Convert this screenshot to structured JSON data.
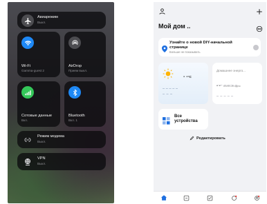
{
  "control_center": {
    "airplane": {
      "label": "Авиарежим",
      "status": "Выкл."
    },
    "wifi": {
      "label": "Wi-Fi",
      "status": "Gamma-guest 2"
    },
    "airdrop": {
      "label": "AirDrop",
      "status": "Прием выкл."
    },
    "cellular": {
      "label": "Сотовые данные",
      "status": "Вкл."
    },
    "bluetooth": {
      "label": "Bluetooth",
      "status": "Вкл. 1"
    },
    "hotspot": {
      "label": "Режим модема",
      "status": "Выкл."
    },
    "vpn": {
      "label": "VPN",
      "status": "Выкл."
    },
    "colors": {
      "airplane": "#4c4c50",
      "wifi": "#1e88f5",
      "airdrop": "#4c4c50",
      "cellular": "#34c759",
      "bluetooth": "#1e88f5"
    }
  },
  "app": {
    "home_title": "Мой дом ..",
    "banner": {
      "title": "Узнайте о новой DIY-начальной странице",
      "subtitle": "Больше не показывать"
    },
    "weather": {
      "temp": "- -",
      "unit": "°C"
    },
    "energy": {
      "title": "Домашнее энерго...",
      "value": "- -",
      "unit": "kWh/Сегодня"
    },
    "devices": {
      "label": "Все устройства"
    },
    "edit": {
      "label": "Редактировать"
    },
    "colors": {
      "accent": "#1e6fe0",
      "sun": "#ffb300",
      "weather_bg": "#e6f0fb"
    }
  }
}
